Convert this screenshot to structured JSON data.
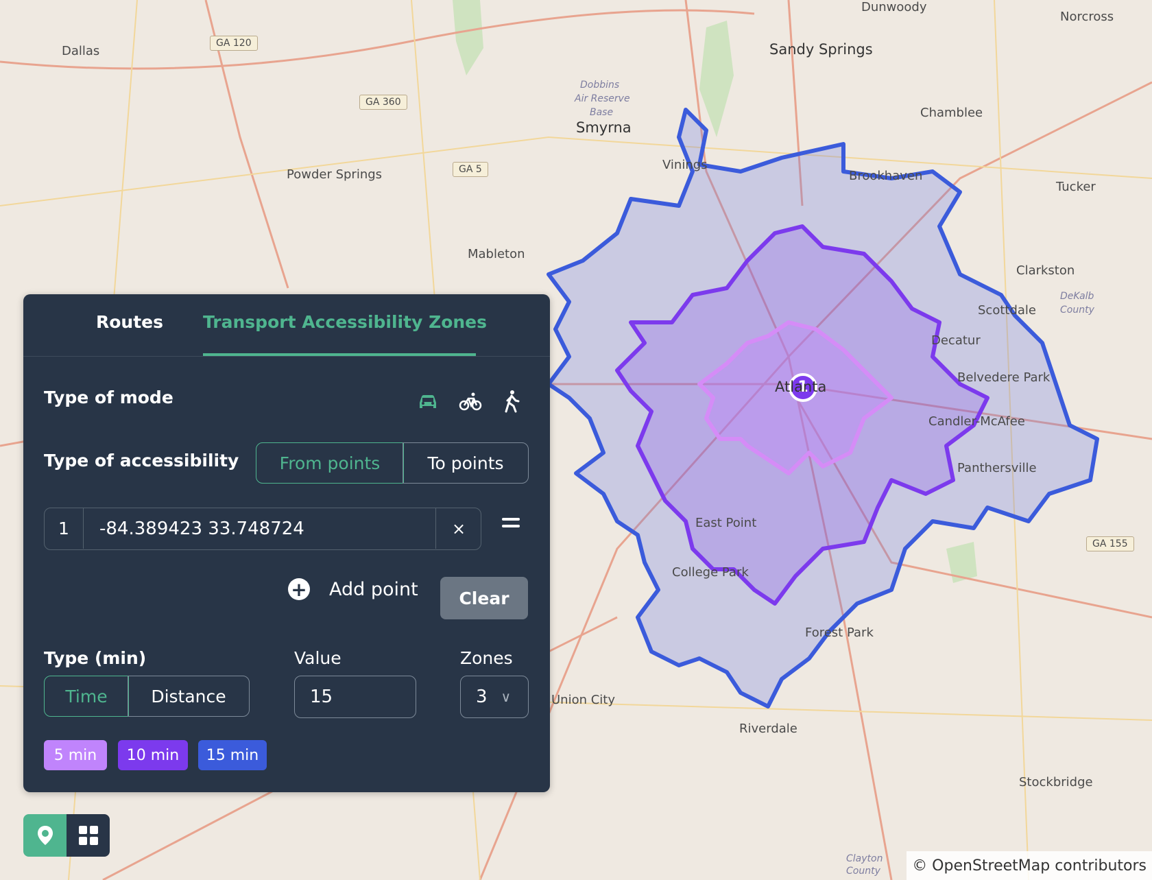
{
  "map": {
    "places": [
      "Dallas",
      "Dunwoody",
      "Norcross",
      "Sandy Springs",
      "Dobbins",
      "Air Reserve",
      "Base",
      "Smyrna",
      "Chamblee",
      "Powder Springs",
      "Vinings",
      "Brookhaven",
      "Tucker",
      "Mableton",
      "Clarkston",
      "DeKalb",
      "County",
      "Scottdale",
      "Decatur",
      "Atlanta",
      "Belvedere Park",
      "Candler-McAfee",
      "Panthersville",
      "East Point",
      "College Park",
      "Forest Park",
      "Union City",
      "Riverdale",
      "Stockbridge",
      "Clayton",
      "County"
    ],
    "shields": [
      "GA 120",
      "GA 360",
      "GA 5",
      "GA 155"
    ],
    "marker": "1",
    "attribution": "© OpenStreetMap contributors"
  },
  "panel": {
    "tabs": {
      "routes": "Routes",
      "zones": "Transport Accessibility Zones"
    },
    "mode_label": "Type of mode",
    "mode_icons": [
      "car-icon",
      "bicycle-icon",
      "walk-icon"
    ],
    "accessibility_label": "Type of accessibility",
    "accessibility_options": {
      "from": "From points",
      "to": "To points"
    },
    "point": {
      "index": "1",
      "value": "-84.389423 33.748724",
      "clear": "×"
    },
    "add_point": "Add point",
    "clear": "Clear",
    "type_label": "Type (min)",
    "type_options": {
      "time": "Time",
      "distance": "Distance"
    },
    "value_label": "Value",
    "value": "15",
    "zones_label": "Zones",
    "zones_value": "3",
    "legend": [
      {
        "label": "5 min",
        "color": "#c084fc"
      },
      {
        "label": "10 min",
        "color": "#7c3aed"
      },
      {
        "label": "15 min",
        "color": "#3b5bdb"
      }
    ],
    "accent_color": "#4fb58f"
  }
}
